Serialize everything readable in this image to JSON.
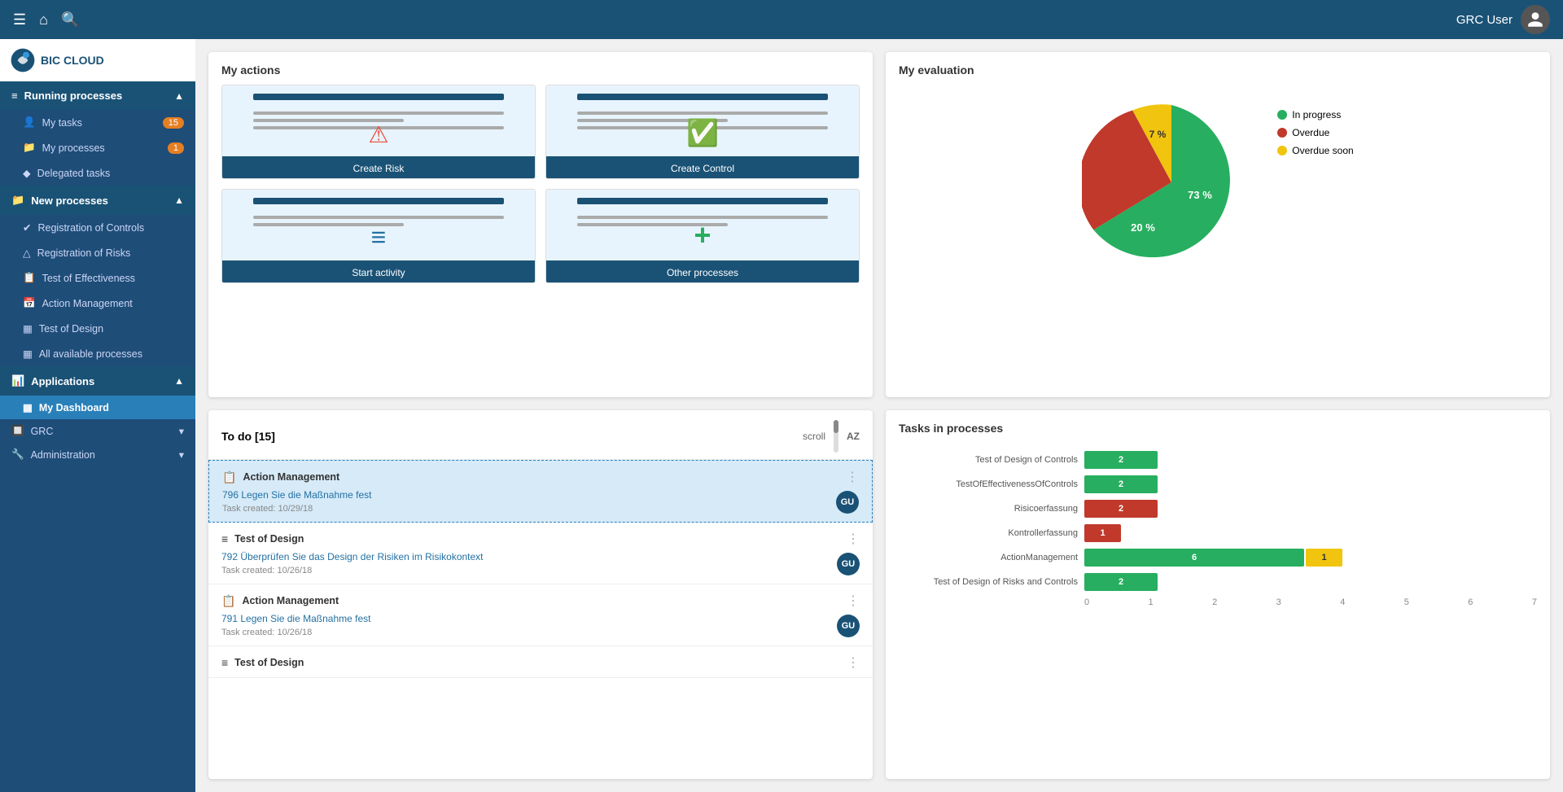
{
  "topNav": {
    "userLabel": "GRC User",
    "icons": [
      "menu",
      "home",
      "search"
    ]
  },
  "sidebar": {
    "logo": "BIC CLOUD",
    "sections": [
      {
        "id": "running-processes",
        "label": "Running processes",
        "icon": "≡",
        "expanded": true,
        "items": [
          {
            "id": "my-tasks",
            "label": "My tasks",
            "badge": "15",
            "badgeColor": "orange"
          },
          {
            "id": "my-processes",
            "label": "My processes",
            "badge": "1",
            "badgeColor": "orange"
          },
          {
            "id": "delegated-tasks",
            "label": "Delegated tasks"
          }
        ]
      },
      {
        "id": "new-processes",
        "label": "New processes",
        "icon": "📁",
        "expanded": true,
        "items": [
          {
            "id": "registration-controls",
            "label": "Registration of Controls",
            "icon": "✓"
          },
          {
            "id": "registration-risks",
            "label": "Registration of Risks",
            "icon": "△"
          },
          {
            "id": "test-effectiveness",
            "label": "Test of Effectiveness",
            "icon": "📋"
          },
          {
            "id": "action-management",
            "label": "Action Management",
            "icon": "📅"
          },
          {
            "id": "test-design",
            "label": "Test of Design",
            "icon": "🔲"
          },
          {
            "id": "all-processes",
            "label": "All available processes",
            "icon": "🔲"
          }
        ]
      },
      {
        "id": "applications",
        "label": "Applications",
        "icon": "📊",
        "expanded": true,
        "items": [
          {
            "id": "my-dashboard",
            "label": "My Dashboard",
            "active": true
          },
          {
            "id": "grc",
            "label": "GRC",
            "hasArrow": true
          },
          {
            "id": "administration",
            "label": "Administration",
            "hasArrow": true
          }
        ]
      }
    ]
  },
  "myActions": {
    "title": "My actions",
    "tiles": [
      {
        "id": "create-risk",
        "label": "Create Risk",
        "iconType": "warning",
        "iconColor": "#e74c3c"
      },
      {
        "id": "create-control",
        "label": "Create Control",
        "iconType": "check",
        "iconColor": "#27ae60"
      },
      {
        "id": "start-activity",
        "label": "Start activity",
        "iconType": "lines",
        "iconColor": "#2471a3"
      },
      {
        "id": "other-processes",
        "label": "Other processes",
        "iconType": "plus",
        "iconColor": "#27ae60"
      }
    ]
  },
  "myEvaluation": {
    "title": "My evaluation",
    "legend": [
      {
        "label": "In progress",
        "color": "#27ae60"
      },
      {
        "label": "Overdue",
        "color": "#c0392b"
      },
      {
        "label": "Overdue soon",
        "color": "#f1c40f"
      }
    ],
    "segments": [
      {
        "label": "73 %",
        "value": 73,
        "color": "#27ae60",
        "startAngle": 0
      },
      {
        "label": "20 %",
        "value": 20,
        "color": "#c0392b",
        "startAngle": 263
      },
      {
        "label": "7 %",
        "value": 7,
        "color": "#f1c40f",
        "startAngle": 335
      }
    ]
  },
  "todo": {
    "title": "To do",
    "count": 15,
    "scrollLabel": "scroll",
    "sortLabel": "AZ",
    "items": [
      {
        "id": "todo-1",
        "category": "Action Management",
        "taskNumber": "796",
        "taskText": "Legen Sie die Maßnahme fest",
        "date": "Task created: 10/29/18",
        "avatar": "GU",
        "highlighted": true
      },
      {
        "id": "todo-2",
        "category": "Test of Design",
        "taskNumber": "792",
        "taskText": "Überprüfen Sie das Design der Risiken im Risikokontext",
        "date": "Task created: 10/26/18",
        "avatar": "GU",
        "highlighted": false
      },
      {
        "id": "todo-3",
        "category": "Action Management",
        "taskNumber": "791",
        "taskText": "Legen Sie die Maßnahme fest",
        "date": "Task created: 10/26/18",
        "avatar": "GU",
        "highlighted": false
      },
      {
        "id": "todo-4",
        "category": "Test of Design",
        "taskNumber": "",
        "taskText": "",
        "date": "",
        "avatar": "",
        "highlighted": false,
        "partial": true
      }
    ]
  },
  "tasksInProcesses": {
    "title": "Tasks in processes",
    "bars": [
      {
        "label": "Test of Design of Controls",
        "green": 2,
        "red": 0,
        "yellow": 0
      },
      {
        "label": "TestOfEffectivenessOfControls",
        "green": 2,
        "red": 0,
        "yellow": 0
      },
      {
        "label": "Risicoerfassung",
        "green": 0,
        "red": 2,
        "yellow": 0
      },
      {
        "label": "Kontrollerfassung",
        "green": 0,
        "red": 1,
        "yellow": 0
      },
      {
        "label": "ActionManagement",
        "green": 6,
        "red": 0,
        "yellow": 1
      },
      {
        "label": "Test of Design of Risks and Controls",
        "green": 2,
        "red": 0,
        "yellow": 0
      }
    ],
    "xAxis": [
      "0",
      "1",
      "2",
      "3",
      "4",
      "5",
      "6",
      "7"
    ]
  }
}
